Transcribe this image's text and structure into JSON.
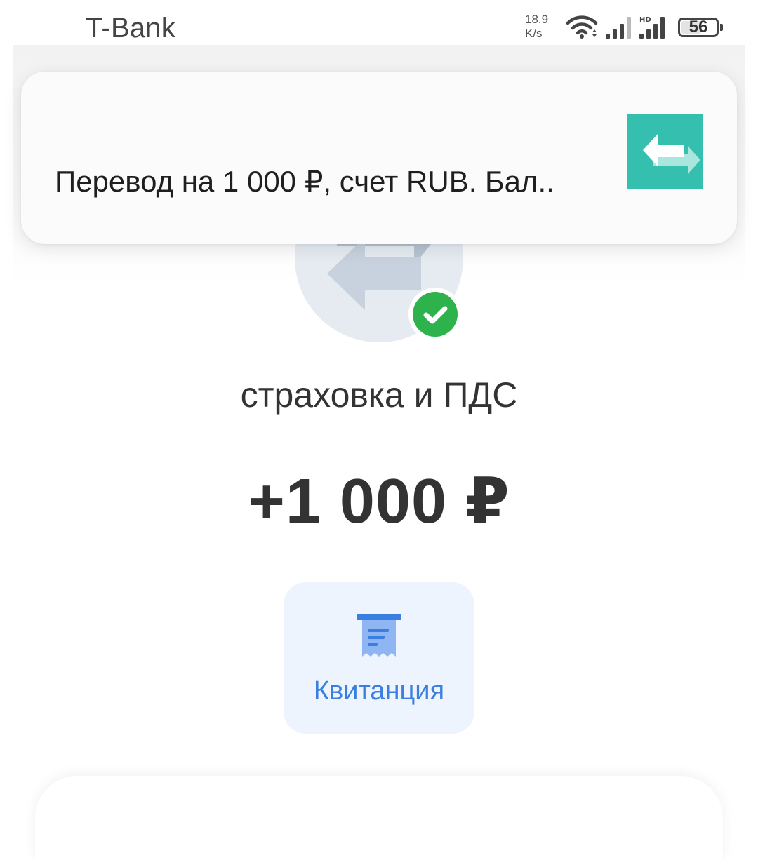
{
  "status_bar": {
    "app_name": "T-Bank",
    "net_speed_value": "18.9",
    "net_speed_unit": "K/s",
    "battery_level": "56",
    "signal_badge": "HD"
  },
  "notification": {
    "text": "Перевод на 1 000 ₽, счет RUB. Бал..",
    "icon": "transfer-arrows-icon",
    "icon_color": "#35bfae"
  },
  "operation": {
    "icon": "transfer-arrows-icon",
    "status_icon": "success-check-icon",
    "status_color": "#2eb24c",
    "name": "страховка и ПДС",
    "amount": "+1 000 ₽"
  },
  "actions": {
    "receipt_label": "Квитанция",
    "receipt_icon": "receipt-icon",
    "accent_color": "#3a7fe0"
  }
}
